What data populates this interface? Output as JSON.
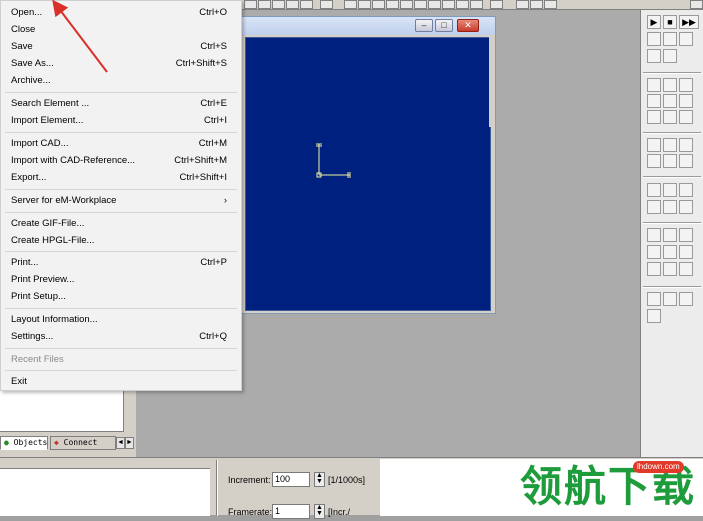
{
  "menu": {
    "items": [
      {
        "label": "Open...",
        "shortcut": "Ctrl+O"
      },
      {
        "label": "Close",
        "shortcut": ""
      },
      {
        "label": "Save",
        "shortcut": "Ctrl+S"
      },
      {
        "label": "Save As...",
        "shortcut": "Ctrl+Shift+S"
      },
      {
        "label": "Archive...",
        "shortcut": ""
      },
      {
        "label": "Search Element ...",
        "shortcut": "Ctrl+E"
      },
      {
        "label": "Import Element...",
        "shortcut": "Ctrl+I"
      },
      {
        "label": "Import CAD...",
        "shortcut": "Ctrl+M"
      },
      {
        "label": "Import with CAD-Reference...",
        "shortcut": "Ctrl+Shift+M"
      },
      {
        "label": "Export...",
        "shortcut": "Ctrl+Shift+I"
      },
      {
        "label": "Server for eM-Workplace",
        "shortcut": "›"
      },
      {
        "label": "Create GIF-File...",
        "shortcut": ""
      },
      {
        "label": "Create HPGL-File...",
        "shortcut": ""
      },
      {
        "label": "Print...",
        "shortcut": "Ctrl+P"
      },
      {
        "label": "Print Preview...",
        "shortcut": ""
      },
      {
        "label": "Print Setup...",
        "shortcut": ""
      },
      {
        "label": "Layout Information...",
        "shortcut": ""
      },
      {
        "label": "Settings...",
        "shortcut": "Ctrl+Q"
      },
      {
        "label": "Recent Files",
        "shortcut": ""
      },
      {
        "label": "Exit",
        "shortcut": ""
      }
    ]
  },
  "inner_window": {
    "minimize": "–",
    "maximize": "□",
    "close": "✕"
  },
  "left_panel": {
    "tabs": [
      "Objects",
      "Connect"
    ],
    "tab_left": "◄",
    "tab_right": "►"
  },
  "bottom": {
    "increment_label": "Increment:",
    "increment_value": "100",
    "increment_unit": "[1/1000s]",
    "framerate_label": "Framerate:",
    "framerate_value": "1",
    "framerate_unit": "[Incr./"
  },
  "palette": {
    "play": "▶",
    "stop": "■",
    "fast_forward": "▶▶"
  },
  "watermark": {
    "text": "领航下载",
    "url": "lhdown.com"
  },
  "colors": {
    "canvas": "#00207f",
    "watermark": "#1e9b3b",
    "arrow": "#d9302a"
  }
}
